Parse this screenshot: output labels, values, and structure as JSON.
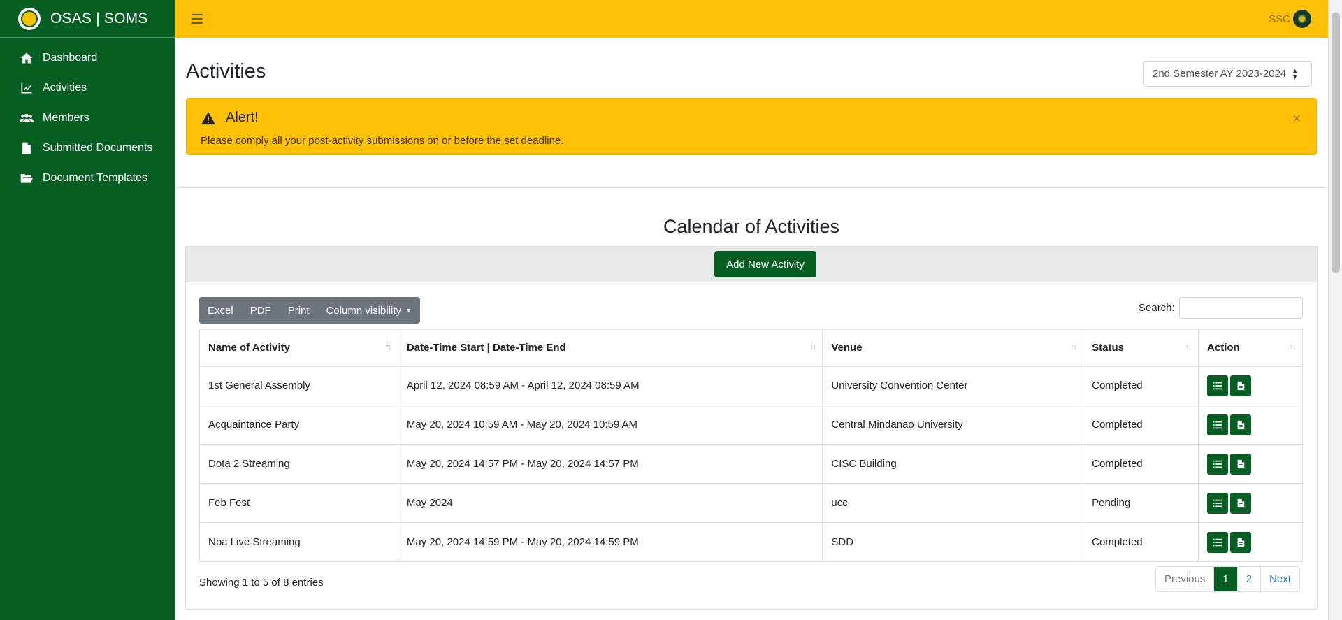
{
  "brand": {
    "title": "OSAS | SOMS"
  },
  "sidebar": {
    "items": [
      {
        "label": "Dashboard",
        "icon": "home-icon"
      },
      {
        "label": "Activities",
        "icon": "chart-line-icon"
      },
      {
        "label": "Members",
        "icon": "users-icon"
      },
      {
        "label": "Submitted Documents",
        "icon": "file-icon"
      },
      {
        "label": "Document Templates",
        "icon": "folder-open-icon"
      }
    ]
  },
  "topbar": {
    "user": "SSC"
  },
  "page": {
    "title": "Activities",
    "semester": "2nd Semester AY 2023-2024"
  },
  "alert": {
    "title": "Alert!",
    "message": "Please comply all your post-activity submissions on or before the set deadline.",
    "close": "×"
  },
  "calendar": {
    "title": "Calendar of Activities",
    "add_button": "Add New Activity"
  },
  "toolbar": {
    "excel": "Excel",
    "pdf": "PDF",
    "print": "Print",
    "column_visibility": "Column visibility",
    "search_label": "Search:"
  },
  "table": {
    "headers": [
      "Name of Activity",
      "Date-Time Start | Date-Time End",
      "Venue",
      "Status",
      "Action"
    ],
    "rows": [
      {
        "name": "1st General Assembly",
        "datetime": "April 12, 2024 08:59 AM - April 12, 2024 08:59 AM",
        "venue": "University Convention Center",
        "status": "Completed"
      },
      {
        "name": "Acquaintance Party",
        "datetime": "May 20, 2024 10:59 AM - May 20, 2024 10:59 AM",
        "venue": "Central Mindanao University",
        "status": "Completed"
      },
      {
        "name": "Dota 2 Streaming",
        "datetime": "May 20, 2024 14:57 PM - May 20, 2024 14:57 PM",
        "venue": "CISC Building",
        "status": "Completed"
      },
      {
        "name": "Feb Fest",
        "datetime": "May 2024",
        "venue": "ucc",
        "status": "Pending"
      },
      {
        "name": "Nba Live Streaming",
        "datetime": "May 20, 2024 14:59 PM - May 20, 2024 14:59 PM",
        "venue": "SDD",
        "status": "Completed"
      }
    ]
  },
  "pagination": {
    "info": "Showing 1 to 5 of 8 entries",
    "previous": "Previous",
    "pages": [
      "1",
      "2"
    ],
    "next": "Next"
  },
  "colors": {
    "primary_green": "#075e22",
    "accent_yellow": "#ffc107"
  }
}
